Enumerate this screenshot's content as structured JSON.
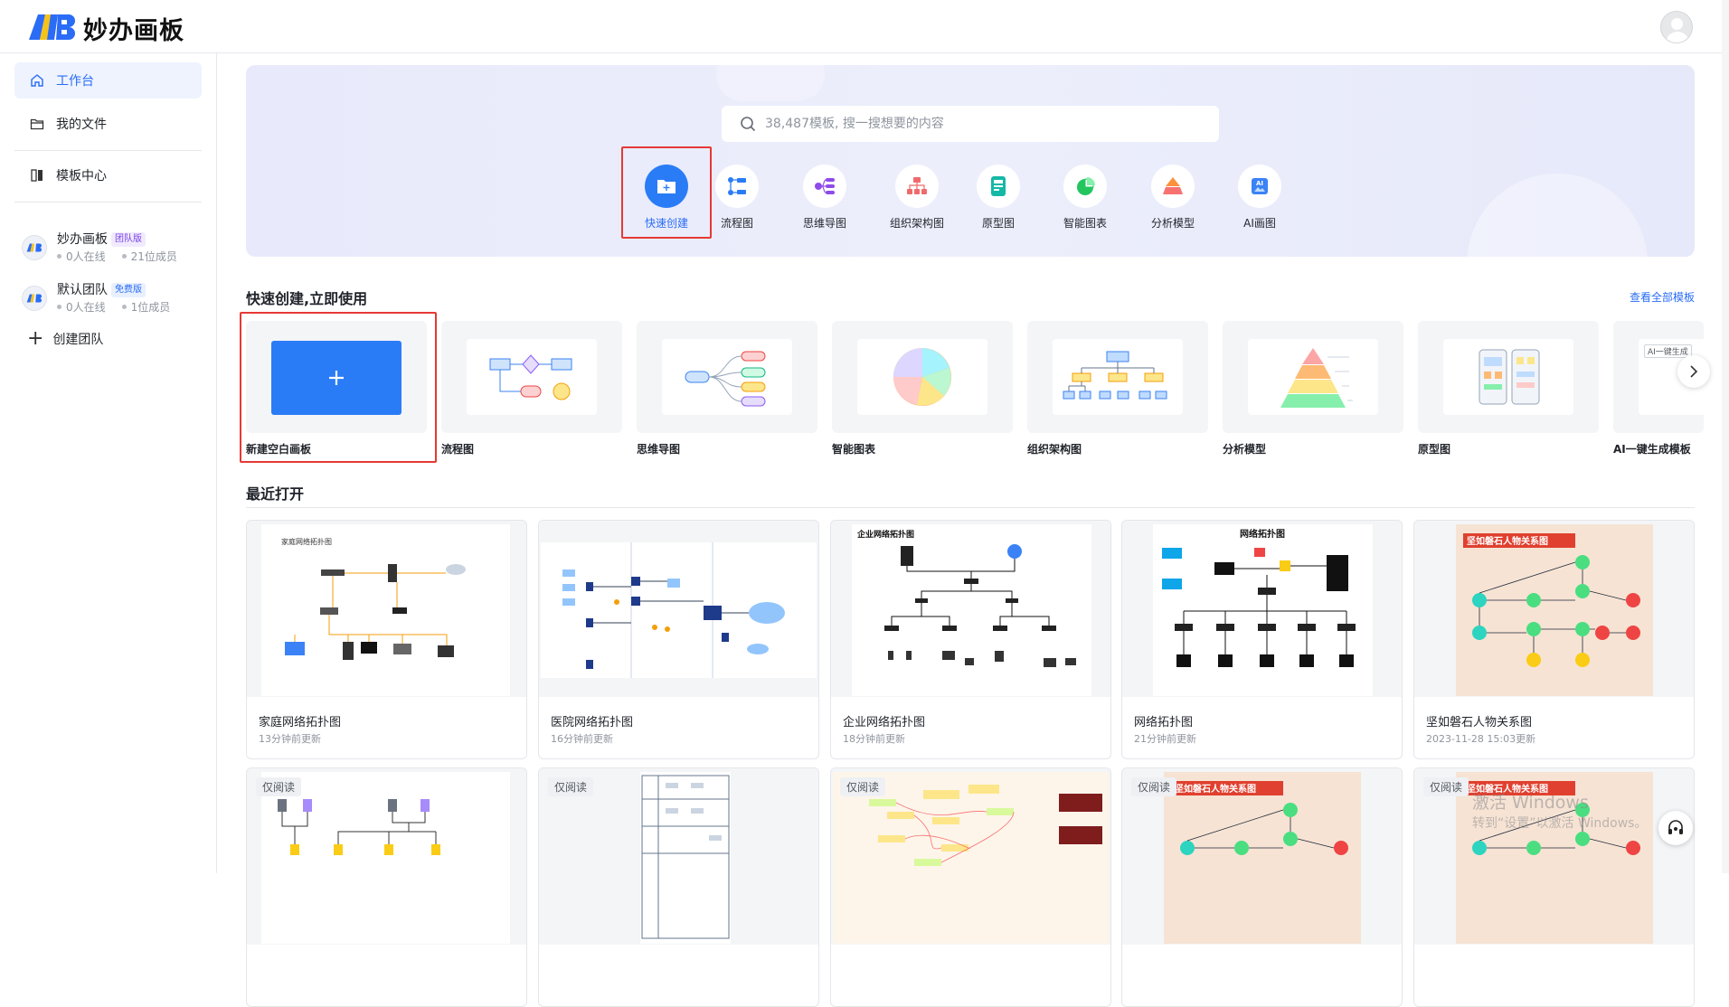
{
  "app": {
    "name": "妙办画板"
  },
  "sidebar": {
    "items": [
      {
        "label": "工作台",
        "icon": "home-icon",
        "active": true
      },
      {
        "label": "我的文件",
        "icon": "folder-icon"
      },
      {
        "label": "模板中心",
        "icon": "template-icon"
      }
    ],
    "teams": [
      {
        "name": "妙办画板",
        "badge": "团队版",
        "online": "0人在线",
        "members": "21位成员"
      },
      {
        "name": "默认团队",
        "badge": "免费版",
        "online": "0人在线",
        "members": "1位成员"
      }
    ],
    "create_team": "创建团队"
  },
  "hero": {
    "search_placeholder": "38,487模板, 搜一搜想要的内容",
    "tools": [
      {
        "label": "快速创建",
        "icon": "folder-plus-icon"
      },
      {
        "label": "流程图",
        "icon": "flowchart-icon"
      },
      {
        "label": "思维导图",
        "icon": "mindmap-icon"
      },
      {
        "label": "组织架构图",
        "icon": "org-chart-icon"
      },
      {
        "label": "原型图",
        "icon": "prototype-icon"
      },
      {
        "label": "智能图表",
        "icon": "pie-chart-icon"
      },
      {
        "label": "分析模型",
        "icon": "pyramid-icon"
      },
      {
        "label": "AI画图",
        "icon": "ai-image-icon"
      }
    ]
  },
  "quick": {
    "title": "快速创建,立即使用",
    "see_all": "查看全部模板",
    "templates": [
      {
        "label": "新建空白画板"
      },
      {
        "label": "流程图"
      },
      {
        "label": "思维导图"
      },
      {
        "label": "智能图表"
      },
      {
        "label": "组织架构图"
      },
      {
        "label": "分析模型"
      },
      {
        "label": "原型图"
      },
      {
        "label": "AI一键生成模板",
        "tag": "AI一键生成"
      }
    ]
  },
  "recent": {
    "title": "最近打开",
    "items": [
      {
        "title": "家庭网络拓扑图",
        "time": "13分钟前更新",
        "thumb_title": "家庭网络拓扑图"
      },
      {
        "title": "医院网络拓扑图",
        "time": "16分钟前更新"
      },
      {
        "title": "企业网络拓扑图",
        "time": "18分钟前更新",
        "thumb_title": "企业网络拓扑图"
      },
      {
        "title": "网络拓扑图",
        "time": "21分钟前更新",
        "thumb_title": "网络拓扑图"
      },
      {
        "title": "坚如磐石人物关系图",
        "time": "2023-11-28 15:03更新",
        "thumb_title": "坚如磐石人物关系图"
      }
    ],
    "row2": [
      {
        "badge": "仅阅读"
      },
      {
        "badge": "仅阅读"
      },
      {
        "badge": "仅阅读"
      },
      {
        "badge": "仅阅读",
        "thumb_title": "坚如磐石人物关系图"
      },
      {
        "badge": "仅阅读",
        "thumb_title": "坚如磐石人物关系图"
      }
    ]
  },
  "watermark": {
    "line1": "激活 Windows",
    "line2": "转到“设置”以激活 Windows。"
  }
}
